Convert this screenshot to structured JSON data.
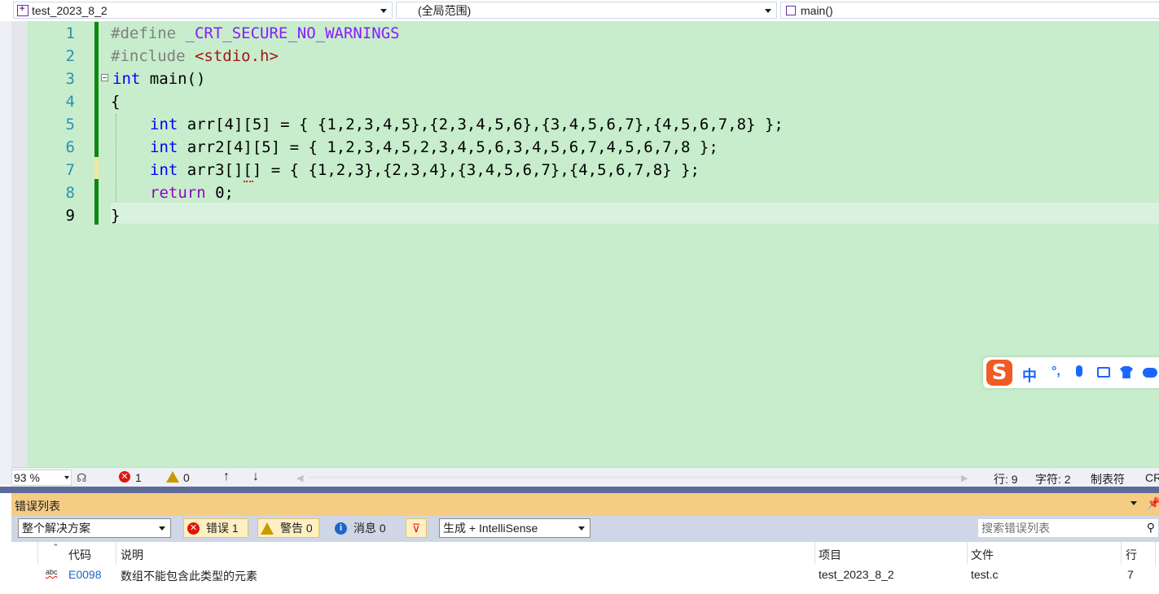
{
  "nav": {
    "project": "test_2023_8_2",
    "scope": "(全局范围)",
    "member": "main()"
  },
  "editor": {
    "line_numbers": [
      "1",
      "2",
      "3",
      "4",
      "5",
      "6",
      "7",
      "8",
      "9"
    ],
    "lines": {
      "l1_a": "#define ",
      "l1_b": "_CRT_SECURE_NO_WARNINGS",
      "l2_a": "#include ",
      "l2_b": "<stdio.h>",
      "l3_a": "int",
      "l3_b": " main()",
      "l4": "{",
      "l5_a": "int",
      "l5_b": " arr[4][5] = { {1,2,3,4,5},{2,3,4,5,6},{3,4,5,6,7},{4,5,6,7,8} };",
      "l6_a": "int",
      "l6_b": " arr2[4][5] = { 1,2,3,4,5,2,3,4,5,6,3,4,5,6,7,4,5,6,7,8 };",
      "l7_a": "int",
      "l7_b": " arr3[][] = { {1,2,3},{2,3,4},{3,4,5,6,7},{4,5,6,7,8} };",
      "l8_a": "return",
      "l8_b": " 0;",
      "l9": "}"
    }
  },
  "status": {
    "zoom": "93 %",
    "errors": "1",
    "warnings": "0",
    "row": "行: 9",
    "col": "字符: 2",
    "tabs": "制表符",
    "eol": "CR"
  },
  "error_list": {
    "title": "错误列表",
    "scope": "整个解决方案",
    "errors_btn": "错误 1",
    "warnings_btn": "警告 0",
    "messages_btn": "消息 0",
    "build_filter": "生成 + IntelliSense",
    "search_placeholder": "搜索错误列表",
    "columns": {
      "code": "代码",
      "desc": "说明",
      "project": "项目",
      "file": "文件",
      "line": "行"
    },
    "rows": [
      {
        "code": "E0098",
        "desc": "数组不能包含此类型的元素",
        "project": "test_2023_8_2",
        "file": "test.c",
        "line": "7"
      }
    ]
  },
  "ime": {
    "lang": "中",
    "punct": "°,"
  },
  "colors": {
    "editor_bg": "#c7edcc",
    "keyword": "#0000ff",
    "macro": "#8a1bff",
    "error_header": "#f5cc84"
  }
}
